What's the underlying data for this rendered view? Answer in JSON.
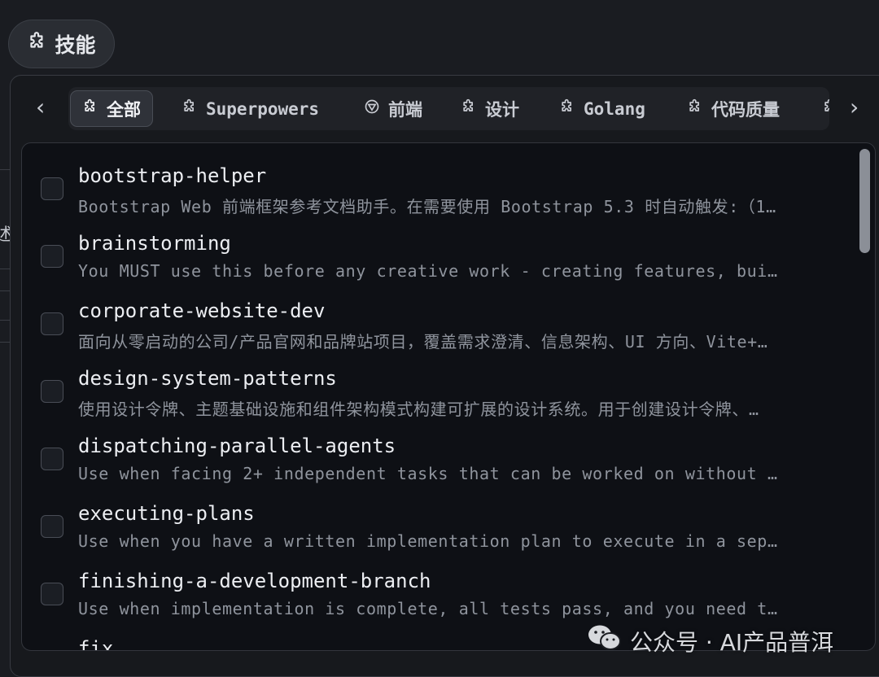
{
  "trigger": {
    "label": "技能",
    "icon": "puzzle-icon"
  },
  "left_edge": {
    "char1": "述",
    "char2": "·"
  },
  "tabs": [
    {
      "label": "全部",
      "icon": "puzzle-icon",
      "active": true
    },
    {
      "label": "Superpowers",
      "icon": "puzzle-icon",
      "active": false
    },
    {
      "label": "前端",
      "icon": "hexagon-icon",
      "active": false
    },
    {
      "label": "设计",
      "icon": "puzzle-icon",
      "active": false
    },
    {
      "label": "Golang",
      "icon": "puzzle-icon",
      "active": false
    },
    {
      "label": "代码质量",
      "icon": "puzzle-icon",
      "active": false
    }
  ],
  "nav": {
    "prev_icon": "chevron-left-icon",
    "next_icon": "chevron-right-icon",
    "prev": "‹",
    "next": "›"
  },
  "skills": [
    {
      "name": "bootstrap-helper",
      "desc": "Bootstrap Web 前端框架参考文档助手。在需要使用 Bootstrap 5.3 时自动触发:（1…"
    },
    {
      "name": "brainstorming",
      "desc": "You MUST use this before any creative work - creating features, bui…"
    },
    {
      "name": "corporate-website-dev",
      "desc": "面向从零启动的公司/产品官网和品牌站项目，覆盖需求澄清、信息架构、UI 方向、Vite+…"
    },
    {
      "name": "design-system-patterns",
      "desc": "使用设计令牌、主题基础设施和组件架构模式构建可扩展的设计系统。用于创建设计令牌、…"
    },
    {
      "name": "dispatching-parallel-agents",
      "desc": "Use when facing 2+ independent tasks that can be worked on without …"
    },
    {
      "name": "executing-plans",
      "desc": "Use when you have a written implementation plan to execute in a sep…"
    },
    {
      "name": "finishing-a-development-branch",
      "desc": "Use when implementation is complete, all tests pass, and you need t…"
    },
    {
      "name": "fix",
      "desc": ""
    }
  ],
  "watermark": {
    "text": "公众号 · AI产品普洱",
    "icon": "wechat-icon"
  },
  "colors": {
    "background": "#1a1c21",
    "list_bg": "#0e1015",
    "text": "#eceef2",
    "muted": "#8f949d"
  }
}
